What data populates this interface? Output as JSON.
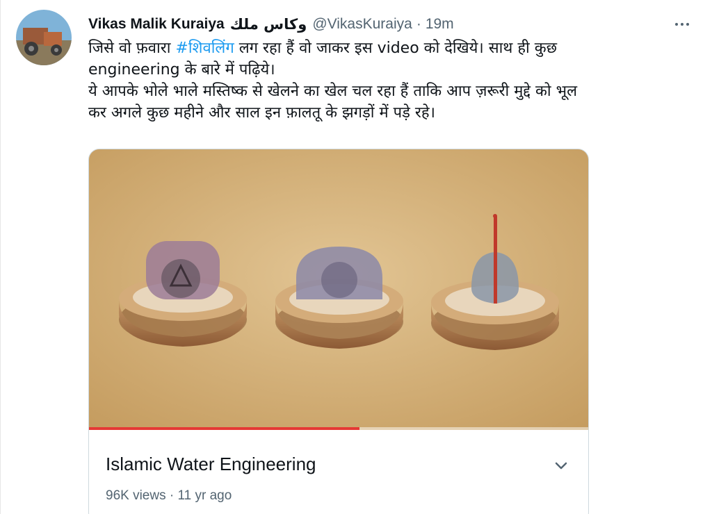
{
  "tweet": {
    "display_name": "Vikas Malik Kuraiya",
    "name_suffix": "وكاس ملك",
    "handle": "@VikasKuraiya",
    "separator": "·",
    "time": "19m",
    "text_line_1_pre": "जिसे वो फ़वारा ",
    "hashtag": "#शिवलिंग",
    "text_line_1_post": " लग रहा हैं वो जाकर इस video को देखिये। साथ ही कुछ",
    "text_line_2": "engineering के बारे में पढ़िये।",
    "text_line_3": "ये आपके भोले भाले मस्तिष्क से खेलने का खेल चल रहा हैं ताकि आप ज़रूरी मुद्दे को भूल",
    "text_line_4": "कर अगले कुछ महीने और साल इन फ़ालतू के झगड़ों में पड़े रहे।"
  },
  "video_card": {
    "title": "Islamic Water Engineering",
    "views": "96K views",
    "separator": "·",
    "age": "11 yr ago",
    "progress_fraction": 0.54
  },
  "icons": {
    "more": "more-horizontal-icon",
    "chevron": "chevron-down-icon"
  },
  "colors": {
    "hashtag": "#1d9bf0",
    "secondary_text": "#536471",
    "progress": "#e53935"
  }
}
